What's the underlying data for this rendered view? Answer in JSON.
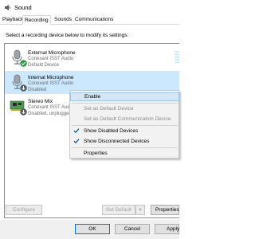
{
  "window": {
    "title": "Sound",
    "icon": "speaker-icon"
  },
  "tabs": [
    {
      "label": "Playback",
      "active": false
    },
    {
      "label": "Recording",
      "active": true
    },
    {
      "label": "Sounds",
      "active": false
    },
    {
      "label": "Communications",
      "active": false
    }
  ],
  "instructions": "Select a recording device below to modify its settings:",
  "devices": [
    {
      "name": "External Microphone",
      "driver": "Conexant ISST Audio",
      "status": "Default Device",
      "icon": "microphone-icon",
      "badge": "green-check-icon",
      "selected": false
    },
    {
      "name": "Internal Microphone",
      "driver": "Conexant ISST Audio",
      "status": "Disabled",
      "icon": "microphone-icon",
      "badge": "disabled-arrow-icon",
      "selected": true
    },
    {
      "name": "Stereo Mix",
      "driver": "Conexant ISST Audio",
      "status": "Disabled, unplugged",
      "icon": "circuit-board-icon",
      "badge": "disabled-arrow-icon",
      "selected": false
    }
  ],
  "context_menu": [
    {
      "label": "Enable",
      "state": "hover"
    },
    {
      "label": "Set as Default Device",
      "state": "disabled"
    },
    {
      "label": "Set as Default Communication Device",
      "state": "disabled"
    },
    {
      "label": "Show Disabled Devices",
      "state": "checked"
    },
    {
      "label": "Show Disconnected Devices",
      "state": "checked"
    },
    {
      "label": "Properties",
      "state": "normal"
    }
  ],
  "buttons": {
    "configure": "Configure",
    "set_default": "Set Default",
    "properties": "Properties",
    "ok": "OK",
    "cancel": "Cancel",
    "apply": "Apply"
  },
  "colors": {
    "selection": "#cce8ff",
    "menu_hover": "#d6e6f5",
    "check": "#0063b1",
    "green_badge": "#2e9b3e"
  }
}
